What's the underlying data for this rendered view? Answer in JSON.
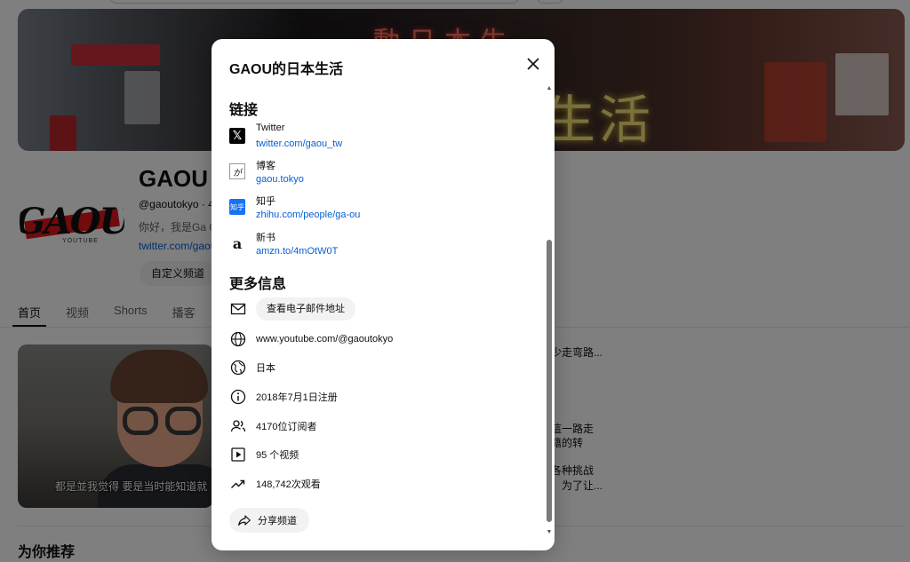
{
  "channel": {
    "name_partial": "GAOU",
    "handle": "@gaoutokyo · 41",
    "desc": "你好，我是Ga Ou",
    "link": "twitter.com/gaou",
    "customize_button": "自定义频道",
    "avatar_text": "GAOU",
    "avatar_sub": "YOUTUBE"
  },
  "banner": {
    "neon_top": "動日本生",
    "neon_main": "生活"
  },
  "tabs": [
    "首页",
    "视频",
    "Shorts",
    "播客"
  ],
  "video": {
    "subtitle": "都是並我觉得 要是当时能知道就"
  },
  "side_snippets": [
    {
      "text": "少走弯路...",
      "gray": false
    },
    {
      "text": "這一路走",
      "gray": true
    },
    {
      "text": "籍的转",
      "gray": true
    },
    {
      "text": "各种挑战",
      "gray": true
    },
    {
      "text": "。为了让...",
      "gray": true
    }
  ],
  "recommend_title": "为你推荐",
  "modal": {
    "title": "GAOU的日本生活",
    "links_heading": "链接",
    "links": [
      {
        "name": "Twitter",
        "url": "twitter.com/gaou_tw",
        "icon": "x-logo-icon",
        "glyph": "𝕏"
      },
      {
        "name": "博客",
        "url": "gaou.tokyo",
        "icon": "blog-logo-icon",
        "glyph": "が"
      },
      {
        "name": "知乎",
        "url": "zhihu.com/people/ga-ou",
        "icon": "zhihu-logo-icon",
        "glyph": "知乎"
      },
      {
        "name": "新书",
        "url": "amzn.to/4mOtW0T",
        "icon": "amazon-logo-icon",
        "glyph": "a"
      }
    ],
    "more_heading": "更多信息",
    "email_button": "查看电子邮件地址",
    "website": "www.youtube.com/@gaoutokyo",
    "country": "日本",
    "joined": "2018年7月1日注册",
    "subscribers": "4170位订阅者",
    "videos": "95 个视频",
    "views": "148,742次观看",
    "share_button": "分享频道"
  }
}
